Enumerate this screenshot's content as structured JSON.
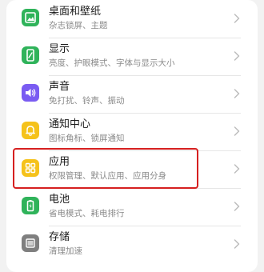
{
  "items": [
    {
      "title": "桌面和壁纸",
      "subtitle": "杂志锁屏、主题",
      "icon": "wallpaper-icon",
      "color": "#2fb35a"
    },
    {
      "title": "显示",
      "subtitle": "亮度、护眼模式、字体与显示大小",
      "icon": "display-icon",
      "color": "#2fb35a"
    },
    {
      "title": "声音",
      "subtitle": "免打扰、铃声、振动",
      "icon": "sound-icon",
      "color": "#7a5cf2"
    },
    {
      "title": "通知中心",
      "subtitle": "图标角标、锁屏通知",
      "icon": "bell-icon",
      "color": "#f5c21b"
    },
    {
      "title": "应用",
      "subtitle": "权限管理、默认应用、应用分身",
      "icon": "apps-icon",
      "color": "#f5c21b"
    },
    {
      "title": "电池",
      "subtitle": "省电模式、耗电排行",
      "icon": "battery-icon",
      "color": "#2fb35a"
    },
    {
      "title": "存储",
      "subtitle": "清理加速",
      "icon": "storage-icon",
      "color": "#7f7f7f"
    }
  ],
  "highlight_color": "#d62020"
}
